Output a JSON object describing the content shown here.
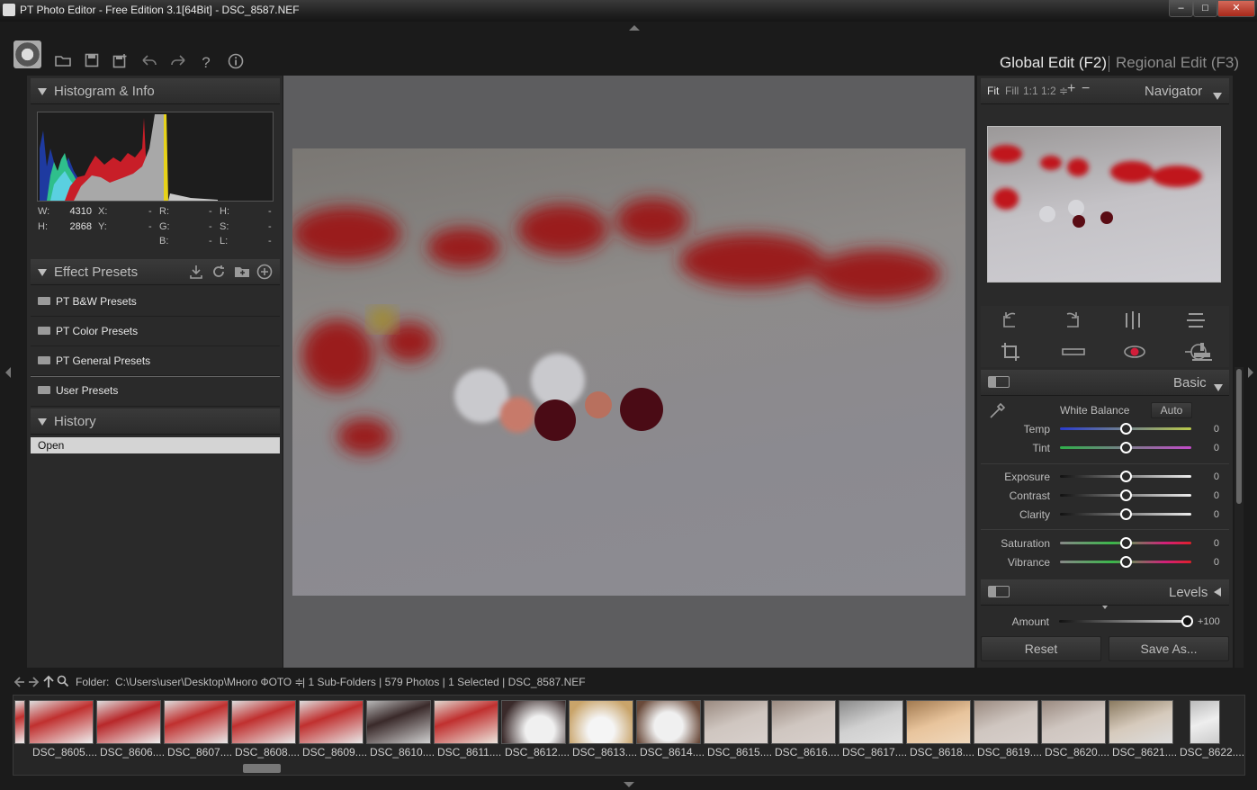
{
  "title_bar": {
    "title": "PT Photo Editor - Free Edition 3.1[64Bit] - DSC_8587.NEF"
  },
  "tabs": {
    "global": "Global Edit (F2)",
    "regional": "Regional Edit (F3)"
  },
  "histogram": {
    "title": "Histogram & Info",
    "w_label": "W:",
    "w_value": "4310",
    "h_label": "H:",
    "h_value": "2868",
    "x_label": "X:",
    "y_label": "Y:",
    "r_label": "R:",
    "g_label": "G:",
    "b_label": "B:",
    "hh_label": "H:",
    "s_label": "S:",
    "l_label": "L:",
    "dash": "-"
  },
  "effect_presets": {
    "title": "Effect Presets",
    "items": [
      "PT B&W Presets",
      "PT Color Presets",
      "PT General Presets",
      "User Presets"
    ]
  },
  "history": {
    "title": "History",
    "items": [
      "Open"
    ]
  },
  "navigator": {
    "title": "Navigator",
    "zoom_fit": "Fit",
    "zoom_fill": "Fill",
    "zoom_1_1": "1:1",
    "zoom_1_2": "1:2 ≑",
    "zoom_in": "+",
    "zoom_out": "−"
  },
  "basic": {
    "title": "Basic",
    "white_balance": "White Balance",
    "auto": "Auto",
    "sliders": [
      {
        "label": "Temp",
        "value": "0"
      },
      {
        "label": "Tint",
        "value": "0"
      },
      {
        "label": "Exposure",
        "value": "0"
      },
      {
        "label": "Contrast",
        "value": "0"
      },
      {
        "label": "Clarity",
        "value": "0"
      },
      {
        "label": "Saturation",
        "value": "0"
      },
      {
        "label": "Vibrance",
        "value": "0"
      }
    ]
  },
  "levels": {
    "title": "Levels"
  },
  "amount": {
    "label": "Amount",
    "value": "+100"
  },
  "buttons": {
    "reset": "Reset",
    "save_as": "Save As..."
  },
  "status": {
    "folder_label": "Folder:",
    "path": "C:\\Users\\user\\Desktop\\Много ФОТО ≑",
    "summary": "| 1 Sub-Folders | 579 Photos | 1 Selected | DSC_8587.NEF"
  },
  "filmstrip": [
    "DSC_8605....",
    "DSC_8606....",
    "DSC_8607....",
    "DSC_8608....",
    "DSC_8609....",
    "DSC_8610....",
    "DSC_8611....",
    "DSC_8612....",
    "DSC_8613....",
    "DSC_8614....",
    "DSC_8615....",
    "DSC_8616....",
    "DSC_8617....",
    "DSC_8618....",
    "DSC_8619....",
    "DSC_8620....",
    "DSC_8621....",
    "DSC_8622...."
  ],
  "icons": {
    "open_folder": "folder-icon",
    "save": "save-icon",
    "save_as": "save-as-icon",
    "undo": "undo-icon",
    "redo": "redo-icon",
    "help": "?",
    "info": "i"
  }
}
